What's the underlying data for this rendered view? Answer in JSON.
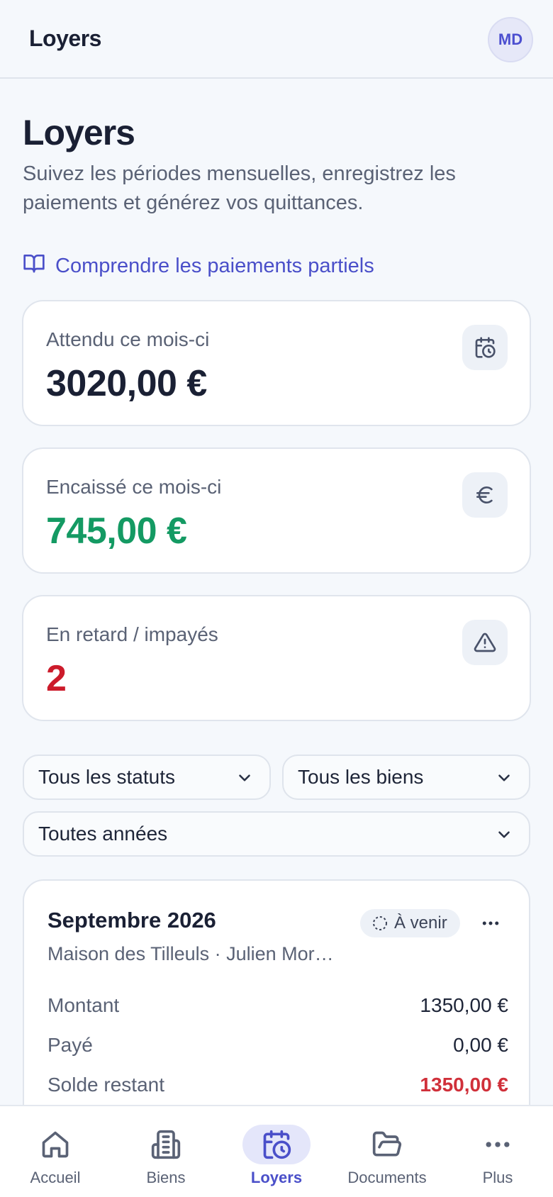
{
  "header": {
    "title": "Loyers",
    "avatar_initials": "MD"
  },
  "page": {
    "title": "Loyers",
    "subtitle": "Suivez les périodes mensuelles, enregistrez les paiements et générez vos quittances.",
    "help_link": "Comprendre les paiements partiels"
  },
  "stats": [
    {
      "label": "Attendu ce mois-ci",
      "value": "3020,00 €",
      "color": "#1a2034",
      "icon": "calendar-clock-icon"
    },
    {
      "label": "Encaissé ce mois-ci",
      "value": "745,00 €",
      "color": "#149a63",
      "icon": "euro-icon"
    },
    {
      "label": "En retard / impayés",
      "value": "2",
      "color": "#cc1b2b",
      "icon": "warning-icon"
    }
  ],
  "filters": {
    "status": "Tous les statuts",
    "property": "Tous les biens",
    "year": "Toutes années"
  },
  "rent_card": {
    "period": "Septembre 2026",
    "status": "À venir",
    "subtitle": "Maison des Tilleuls · Julien Mor…",
    "rows": [
      {
        "label": "Montant",
        "value": "1350,00 €"
      },
      {
        "label": "Payé",
        "value": "0,00 €"
      },
      {
        "label": "Solde restant",
        "value": "1350,00 €"
      }
    ]
  },
  "nav": {
    "items": [
      {
        "label": "Accueil",
        "icon": "home-icon"
      },
      {
        "label": "Biens",
        "icon": "building-icon"
      },
      {
        "label": "Loyers",
        "icon": "calendar-clock-icon"
      },
      {
        "label": "Documents",
        "icon": "folder-icon"
      },
      {
        "label": "Plus",
        "icon": "more-icon"
      }
    ],
    "active": "Loyers"
  },
  "colors": {
    "accent": "#4a4fc9",
    "success": "#149a63",
    "danger": "#cc1b2b"
  }
}
